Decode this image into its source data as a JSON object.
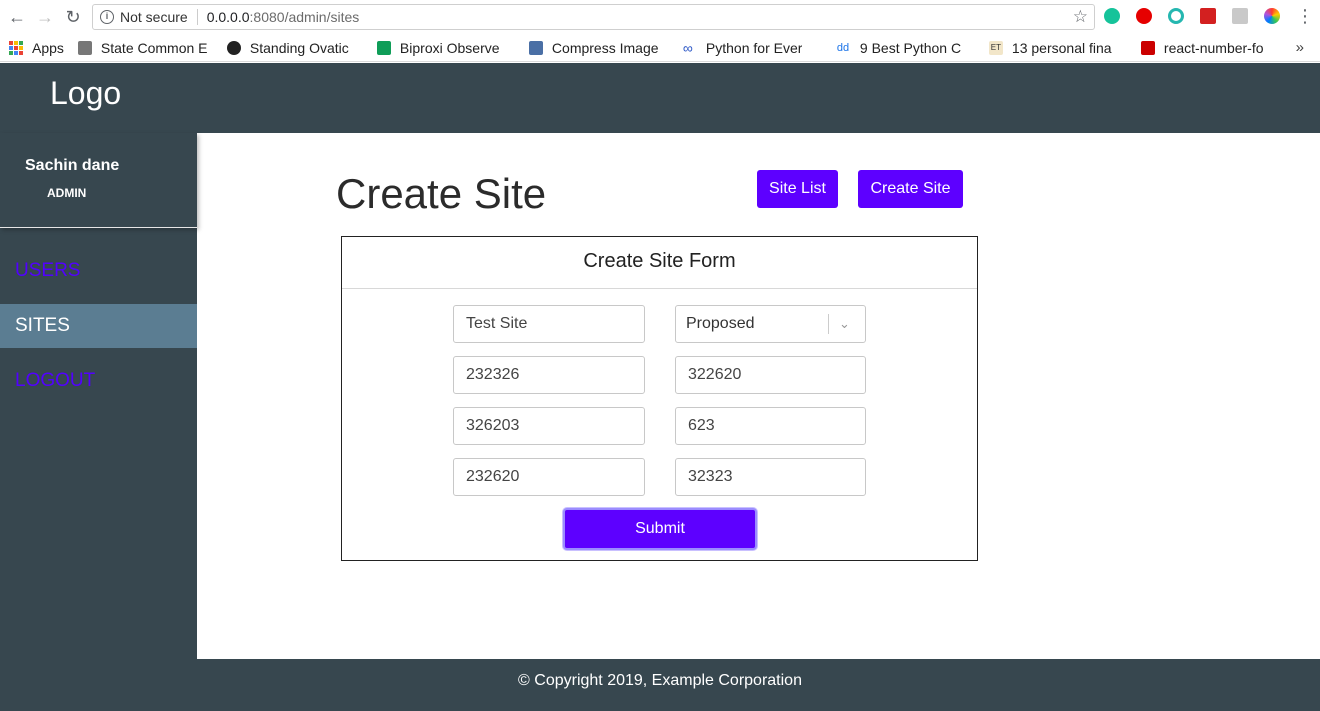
{
  "browser": {
    "security_label": "Not secure",
    "url_host": "0.0.0.0",
    "url_path": ":8080/admin/sites",
    "bookmarks": [
      {
        "label": "Apps",
        "icon": "apps-grid-icon"
      },
      {
        "label": "State Common E",
        "icon": "emblem-icon"
      },
      {
        "label": "Standing Ovatic",
        "icon": "b-circle-icon"
      },
      {
        "label": "Biproxi Observe",
        "icon": "sheets-icon"
      },
      {
        "label": "Compress Image",
        "icon": "monitor-icon"
      },
      {
        "label": "Python for Ever",
        "icon": "infinity-icon"
      },
      {
        "label": "9 Best Python C",
        "icon": "dd-icon"
      },
      {
        "label": "13 personal fina",
        "icon": "et-icon"
      },
      {
        "label": "react-number-fo",
        "icon": "npm-icon"
      }
    ]
  },
  "header": {
    "logo": "Logo"
  },
  "sidebar": {
    "user_name": "Sachin dane",
    "user_role": "ADMIN",
    "items": [
      {
        "label": "USERS",
        "active": false
      },
      {
        "label": "SITES",
        "active": true
      },
      {
        "label": "LOGOUT",
        "active": false
      }
    ]
  },
  "main": {
    "title": "Create Site",
    "site_list_button": "Site List",
    "create_site_button": "Create Site",
    "form": {
      "title": "Create Site Form",
      "site_name": "Test Site",
      "status": "Proposed",
      "field_2": "232326",
      "field_3": "322620",
      "field_4": "326203",
      "field_5": "623",
      "field_6": "232620",
      "field_7": "32323",
      "submit_label": "Submit"
    }
  },
  "footer": {
    "copyright": "© Copyright 2019, Example Corporation"
  },
  "colors": {
    "primary": "#5d00ff",
    "dark": "#37474f",
    "active": "#5b7d92"
  }
}
